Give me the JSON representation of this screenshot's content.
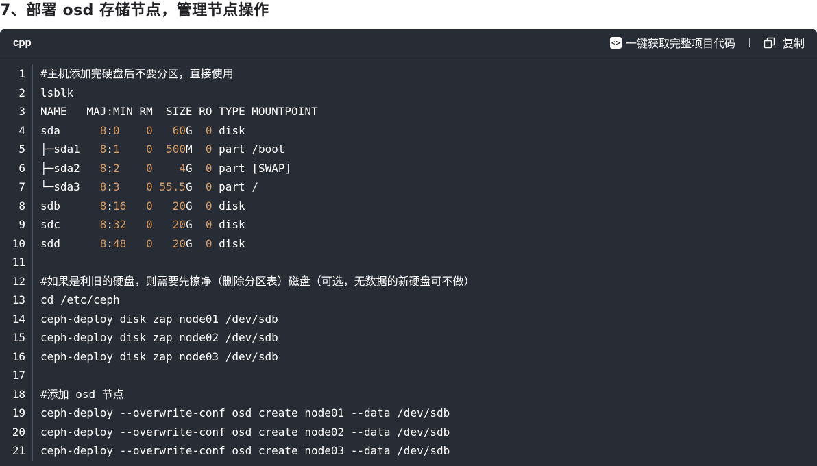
{
  "heading": "7、部署 osd 存储节点，管理节点操作",
  "code_block": {
    "language": "cpp",
    "get_full_code_label": "一键获取完整项目代码",
    "copy_label": "复制",
    "accent_number_color": "#d19a66",
    "background_color": "#282c34",
    "lines": [
      {
        "n": "1",
        "segments": [
          {
            "t": "#主机添加完硬盘后不要分区，直接使用"
          }
        ]
      },
      {
        "n": "2",
        "segments": [
          {
            "t": "lsblk"
          }
        ]
      },
      {
        "n": "3",
        "segments": [
          {
            "t": "NAME   MAJ:MIN RM  SIZE RO TYPE MOUNTPOINT"
          }
        ]
      },
      {
        "n": "4",
        "segments": [
          {
            "t": "sda      "
          },
          {
            "t": "8",
            "c": "num"
          },
          {
            "t": ":"
          },
          {
            "t": "0",
            "c": "num"
          },
          {
            "t": "    "
          },
          {
            "t": "0",
            "c": "num"
          },
          {
            "t": "   "
          },
          {
            "t": "60",
            "c": "num"
          },
          {
            "t": "G  "
          },
          {
            "t": "0",
            "c": "num"
          },
          {
            "t": " disk"
          }
        ]
      },
      {
        "n": "5",
        "segments": [
          {
            "t": "├─sda1   "
          },
          {
            "t": "8",
            "c": "num"
          },
          {
            "t": ":"
          },
          {
            "t": "1",
            "c": "num"
          },
          {
            "t": "    "
          },
          {
            "t": "0",
            "c": "num"
          },
          {
            "t": "  "
          },
          {
            "t": "500",
            "c": "num"
          },
          {
            "t": "M  "
          },
          {
            "t": "0",
            "c": "num"
          },
          {
            "t": " part /boot"
          }
        ]
      },
      {
        "n": "6",
        "segments": [
          {
            "t": "├─sda2   "
          },
          {
            "t": "8",
            "c": "num"
          },
          {
            "t": ":"
          },
          {
            "t": "2",
            "c": "num"
          },
          {
            "t": "    "
          },
          {
            "t": "0",
            "c": "num"
          },
          {
            "t": "    "
          },
          {
            "t": "4",
            "c": "num"
          },
          {
            "t": "G  "
          },
          {
            "t": "0",
            "c": "num"
          },
          {
            "t": " part [SWAP]"
          }
        ]
      },
      {
        "n": "7",
        "segments": [
          {
            "t": "└─sda3   "
          },
          {
            "t": "8",
            "c": "num"
          },
          {
            "t": ":"
          },
          {
            "t": "3",
            "c": "num"
          },
          {
            "t": "    "
          },
          {
            "t": "0",
            "c": "num"
          },
          {
            "t": " "
          },
          {
            "t": "55.5",
            "c": "num"
          },
          {
            "t": "G  "
          },
          {
            "t": "0",
            "c": "num"
          },
          {
            "t": " part /"
          }
        ]
      },
      {
        "n": "8",
        "segments": [
          {
            "t": "sdb      "
          },
          {
            "t": "8",
            "c": "num"
          },
          {
            "t": ":"
          },
          {
            "t": "16",
            "c": "num"
          },
          {
            "t": "   "
          },
          {
            "t": "0",
            "c": "num"
          },
          {
            "t": "   "
          },
          {
            "t": "20",
            "c": "num"
          },
          {
            "t": "G  "
          },
          {
            "t": "0",
            "c": "num"
          },
          {
            "t": " disk"
          }
        ]
      },
      {
        "n": "9",
        "segments": [
          {
            "t": "sdc      "
          },
          {
            "t": "8",
            "c": "num"
          },
          {
            "t": ":"
          },
          {
            "t": "32",
            "c": "num"
          },
          {
            "t": "   "
          },
          {
            "t": "0",
            "c": "num"
          },
          {
            "t": "   "
          },
          {
            "t": "20",
            "c": "num"
          },
          {
            "t": "G  "
          },
          {
            "t": "0",
            "c": "num"
          },
          {
            "t": " disk"
          }
        ]
      },
      {
        "n": "10",
        "segments": [
          {
            "t": "sdd      "
          },
          {
            "t": "8",
            "c": "num"
          },
          {
            "t": ":"
          },
          {
            "t": "48",
            "c": "num"
          },
          {
            "t": "   "
          },
          {
            "t": "0",
            "c": "num"
          },
          {
            "t": "   "
          },
          {
            "t": "20",
            "c": "num"
          },
          {
            "t": "G  "
          },
          {
            "t": "0",
            "c": "num"
          },
          {
            "t": " disk"
          }
        ]
      },
      {
        "n": "11",
        "segments": [
          {
            "t": ""
          }
        ]
      },
      {
        "n": "12",
        "segments": [
          {
            "t": "#如果是利旧的硬盘，则需要先擦净（删除分区表）磁盘（可选，无数据的新硬盘可不做）"
          }
        ]
      },
      {
        "n": "13",
        "segments": [
          {
            "t": "cd /etc/ceph"
          }
        ]
      },
      {
        "n": "14",
        "segments": [
          {
            "t": "ceph-deploy disk zap node01 /dev/sdb"
          }
        ]
      },
      {
        "n": "15",
        "segments": [
          {
            "t": "ceph-deploy disk zap node02 /dev/sdb"
          }
        ]
      },
      {
        "n": "16",
        "segments": [
          {
            "t": "ceph-deploy disk zap node03 /dev/sdb"
          }
        ]
      },
      {
        "n": "17",
        "segments": [
          {
            "t": ""
          }
        ]
      },
      {
        "n": "18",
        "segments": [
          {
            "t": "#添加 osd 节点"
          }
        ]
      },
      {
        "n": "19",
        "segments": [
          {
            "t": "ceph-deploy --overwrite-conf osd create node01 --data /dev/sdb"
          }
        ]
      },
      {
        "n": "20",
        "segments": [
          {
            "t": "ceph-deploy --overwrite-conf osd create node02 --data /dev/sdb"
          }
        ]
      },
      {
        "n": "21",
        "segments": [
          {
            "t": "ceph-deploy --overwrite-conf osd create node03 --data /dev/sdb"
          }
        ]
      }
    ]
  }
}
